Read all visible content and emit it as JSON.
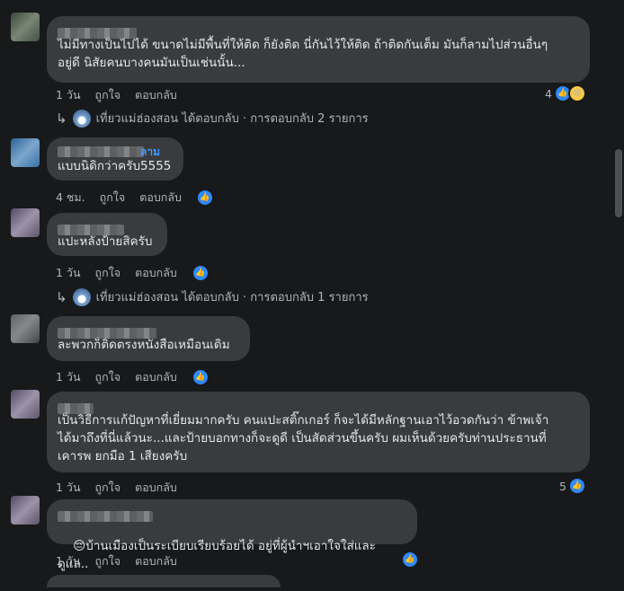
{
  "actions": {
    "like": "ถูกใจ",
    "reply": "ตอบกลับ"
  },
  "comments": [
    {
      "text": "ไม่มีทางเป็นไปได้ ขนาดไม่มีพื้นที่ให้ติด ก็ยังติด นี่กันไว้ให้ติด ถ้าติดกันเต็ม มันก็ลามไปส่วนอื่นๆ\nอยู่ดี นิสัยคนบางคนมันเป็นเช่นนั้น...",
      "time": "1 วัน",
      "reaction_count": "4"
    },
    {
      "name_tail": "ลาม",
      "text": "แบบนิดิกว่าครับ5555",
      "time": "4 ชม."
    },
    {
      "text": "แปะหลังป้ายสิครับ",
      "time": "1 วัน"
    },
    {
      "text": "ละพวกก็ติดตรงหนังสือเหมือนเดิม",
      "time": "1 วัน"
    },
    {
      "text": "เป็นวิธีการแก้ปัญหาที่เยี่ยมมากครับ คนแปะสติ๊กเกอร์ ก็จะได้มีหลักฐานเอาไว้อวดกันว่า ข้าพเจ้า\nได้มาถึงที่นี่แล้วนะ...และป้ายบอกทางก็จะดูดี เป็นสัดส่วนขึ้นครับ ผมเห็นด้วยครับท่านประธานที่\nเคารพ ยกมือ 1 เสียงครับ",
      "time": "1 วัน",
      "reaction_count": "5"
    },
    {
      "emoji": "😔",
      "text": "บ้านเมืองเป็นระเบียบเรียบร้อยได้ อยู่ที่ผู้นำฯเอาใจใส่และดูแล..",
      "time": "1 วัน"
    }
  ],
  "replies": [
    {
      "page_name": "เที่ยวแม่ฮ่องสอน",
      "text": " ได้ตอบกลับ · การตอบกลับ 2 รายการ"
    },
    {
      "page_name": "เที่ยวแม่ฮ่องสอน",
      "text": " ได้ตอบกลับ · การตอบกลับ 1 รายการ"
    }
  ],
  "colors": {
    "background": "#18191a",
    "bubble": "#3a3b3c",
    "like_blue": "#2e89ff",
    "name_blue": "#4599ff"
  }
}
